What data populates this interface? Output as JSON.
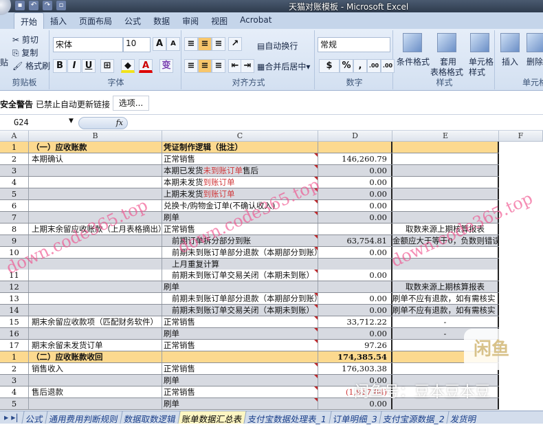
{
  "window": {
    "title": "天猫对账模板 - Microsoft Excel"
  },
  "ribbon_tabs": [
    "开始",
    "插入",
    "页面布局",
    "公式",
    "数据",
    "审阅",
    "视图",
    "Acrobat"
  ],
  "clipboard": {
    "paste": "贴",
    "cut": "剪切",
    "copy": "复制",
    "format_painter": "格式刷",
    "label": "剪贴板"
  },
  "font": {
    "name": "宋体",
    "size": "10",
    "bold": "B",
    "italic": "I",
    "underline": "U",
    "grow": "A",
    "shrink": "A",
    "label": "字体",
    "phonetic": "变"
  },
  "alignment": {
    "wrap": "自动换行",
    "merge": "合并后居中",
    "label": "对齐方式"
  },
  "number": {
    "format": "常规",
    "percent": "%",
    "comma": ",",
    "inc": ".00",
    "dec": ".00",
    "label": "数字"
  },
  "styles": {
    "conditional": "条件格式",
    "table_1": "套用",
    "table_2": "表格格式",
    "cell_1": "单元格",
    "cell_2": "样式",
    "label": "样式"
  },
  "cells": {
    "insert": "插入",
    "delete": "删除",
    "label": "单元格"
  },
  "security": {
    "warning": "安全警告",
    "message": "已禁止自动更新链接",
    "options": "选项..."
  },
  "formula_bar": {
    "name_box": "G24",
    "fx": "fx",
    "value": ""
  },
  "columns": [
    "A",
    "B",
    "C",
    "D",
    "E",
    "F"
  ],
  "rows": [
    {
      "n": "1",
      "b": "（一）应收账款",
      "c": "凭证制作逻辑（批注）",
      "d": "",
      "e": "",
      "style": "yellow",
      "bold": true
    },
    {
      "n": "2",
      "b": "本期确认",
      "c": "正常销售",
      "d": "146,260.79",
      "e": "",
      "style": "white"
    },
    {
      "n": "3",
      "b": "",
      "c": "本期已发货",
      "c_red": "未到账订单",
      "c_tail": "售后",
      "d": "0.00",
      "e": "",
      "style": "gray"
    },
    {
      "n": "4",
      "b": "",
      "c": "本期未发货",
      "c_red": "到账订单",
      "d": "0.00",
      "e": "",
      "style": "white"
    },
    {
      "n": "5",
      "b": "",
      "c": "上期未发货",
      "c_red": "到账订单",
      "d": "0.00",
      "e": "",
      "style": "gray"
    },
    {
      "n": "6",
      "b": "",
      "c": "兑换卡/购物金订单(不确认收入)",
      "d": "0.00",
      "e": "",
      "style": "white"
    },
    {
      "n": "7",
      "b": "",
      "c": "刷单",
      "d": "0.00",
      "e": "",
      "style": "gray"
    },
    {
      "n": "8",
      "b": "上期末余留应收账款（上月表格摘出）",
      "c": "正常销售",
      "d": "",
      "e": "取数来源上期核算报表",
      "style": "white"
    },
    {
      "n": "9",
      "b": "",
      "c": "前期订单拆分部分到账",
      "indent": true,
      "d": "63,754.81",
      "e": "金额应大于等于0，负数则错误",
      "style": "gray"
    },
    {
      "n": "10",
      "b": "",
      "c": "前期未到账订单部分退款（本期部分到账）",
      "indent": true,
      "d": "0.00",
      "e": "",
      "style": "white"
    },
    {
      "n": "",
      "b": "",
      "c": "上月重复计算",
      "indent": true,
      "d": "",
      "e": "",
      "style": "gray"
    },
    {
      "n": "11",
      "b": "",
      "c": "前期未到账订单交易关闭（本期未到账）",
      "indent": true,
      "d": "0.00",
      "e": "",
      "style": "white"
    },
    {
      "n": "12",
      "b": "",
      "c": "刷单",
      "d": "",
      "e": "取数来源上期核算报表",
      "style": "gray"
    },
    {
      "n": "13",
      "b": "",
      "c": "前期未到账订单部分退款（本期部分到账）",
      "indent": true,
      "d": "0.00",
      "e": "刷单不应有退款，如有需核实",
      "style": "white"
    },
    {
      "n": "14",
      "b": "",
      "c": "前期未到账订单交易关闭（本期未到账）",
      "indent": true,
      "d": "0.00",
      "e": "刷单不应有退款，如有需核实",
      "style": "gray"
    },
    {
      "n": "15",
      "b": "期末余留应收款项（匹配财务软件）",
      "c": "正常销售",
      "d": "33,712.22",
      "e": "-",
      "style": "white"
    },
    {
      "n": "16",
      "b": "",
      "c": "刷单",
      "d": "0.00",
      "e": "-",
      "style": "gray"
    },
    {
      "n": "17",
      "b": "期末余留未发货订单",
      "c": "正常销售",
      "d": "97.26",
      "e": "",
      "style": "white"
    },
    {
      "n": "1",
      "b": "（二）应收账款收回",
      "c": "",
      "d": "174,385.54",
      "e": "",
      "style": "yellow",
      "bold": true
    },
    {
      "n": "2",
      "b": "销售收入",
      "c": "正常销售",
      "d": "176,303.38",
      "e": "",
      "style": "white"
    },
    {
      "n": "3",
      "b": "",
      "c": "刷单",
      "d": "0.00",
      "e": "",
      "style": "gray"
    },
    {
      "n": "4",
      "b": "售后退款",
      "c": "正常销售",
      "d": "(1,917.84)",
      "e": "",
      "style": "white",
      "red_d": true
    },
    {
      "n": "5",
      "b": "",
      "c": "刷单",
      "d": "0.00",
      "e": "",
      "style": "gray"
    }
  ],
  "sheet_tabs": [
    "公式",
    "通用费用判断规则",
    "数据取数逻辑",
    "账单数据汇总表",
    "支付宝数据处理表_1",
    "订单明细_3",
    "支付宝源数据_2",
    "发货明"
  ],
  "active_sheet": "账单数据汇总表",
  "watermarks": {
    "site": "down.code365.top",
    "xianyu_logo": "闲鱼",
    "xianyu_id": "闲鱼号：豆本豆本豆"
  },
  "colors": {
    "header_yellow": "#fcd98f",
    "row_gray": "#d7dae1",
    "red_text": "#d0383a"
  }
}
